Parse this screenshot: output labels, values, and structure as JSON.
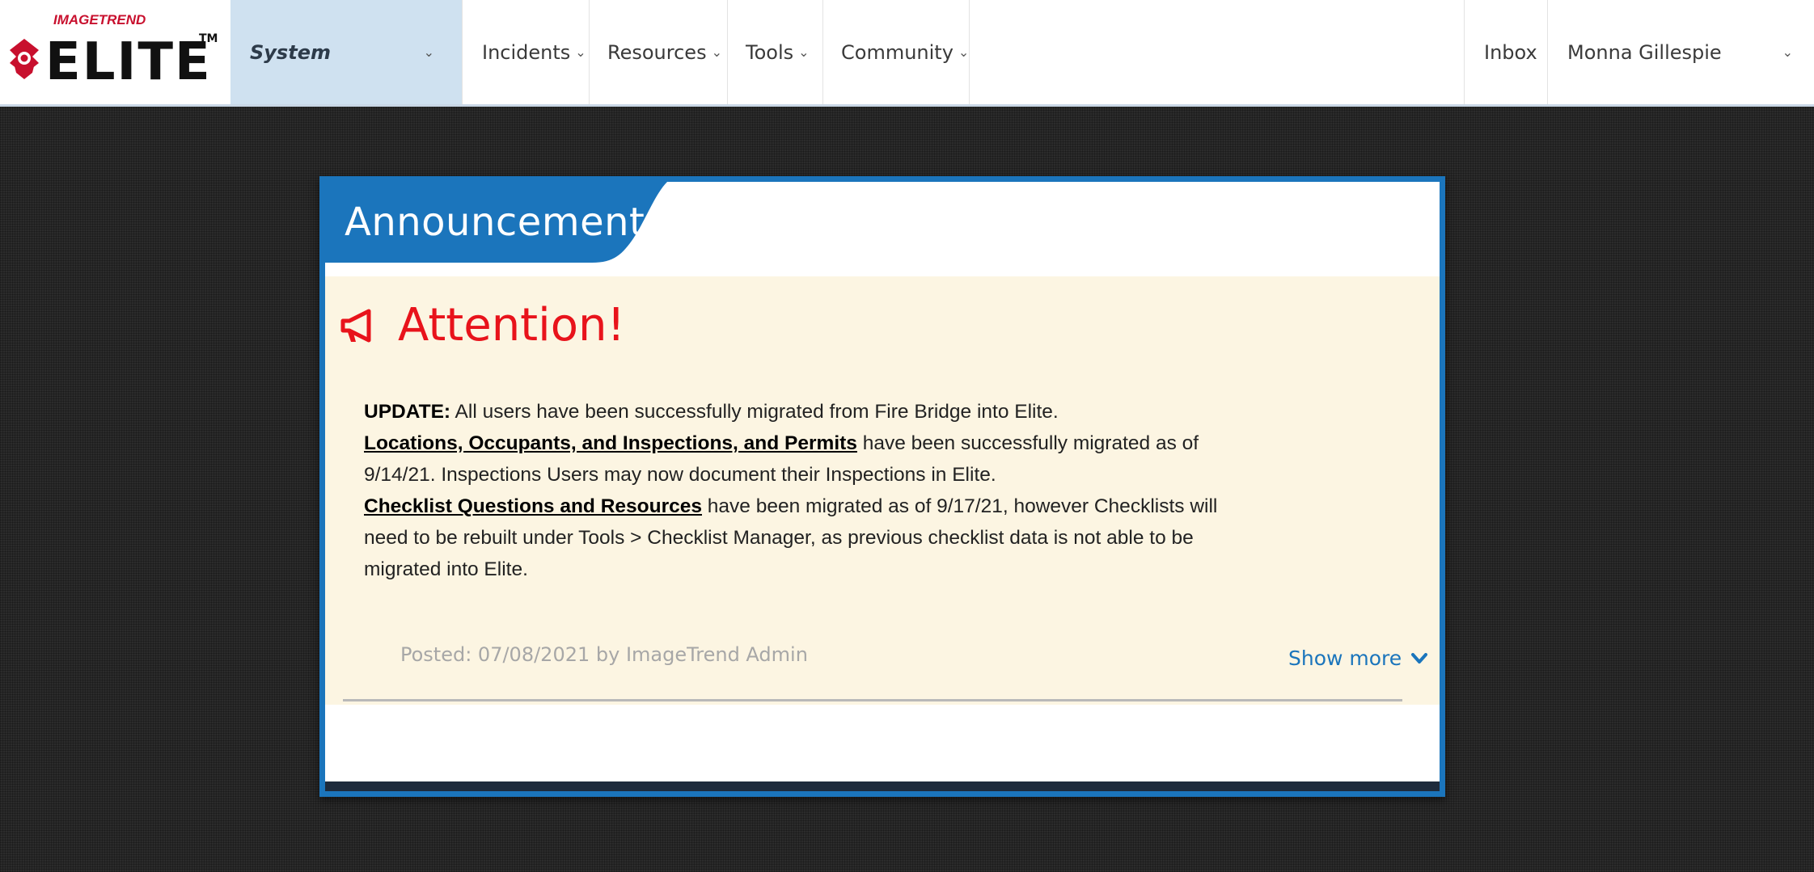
{
  "header": {
    "logo": {
      "small_text": "IMAGETREND",
      "big_text": "ELITE",
      "tm": "TM",
      "icon": "maltese-cross-icon"
    },
    "nav": [
      {
        "label": "System"
      },
      {
        "label": "Incidents"
      },
      {
        "label": "Resources"
      },
      {
        "label": "Tools"
      },
      {
        "label": "Community"
      }
    ],
    "inbox_label": "Inbox",
    "user_name": "Monna Gillespie",
    "chevron_icon": "chevron-down-icon"
  },
  "announcements": {
    "title": "Announcements",
    "items": [
      {
        "heading": "Attention!",
        "heading_icon": "megaphone-icon",
        "paragraphs": [
          {
            "strong": "UPDATE:",
            "text": " All users have been successfully migrated from Fire Bridge into Elite."
          },
          {
            "link": "Locations, Occupants, and Inspections, and Permits",
            "text": " have been successfully migrated as of 9/14/21. Inspections Users may now document their Inspections in Elite."
          },
          {
            "link": "Checklist Questions and Resources",
            "text": " have been migrated as of 9/17/21, however Checklists will need to be rebuilt under Tools > Checklist Manager, as previous checklist data is not able to be migrated into Elite."
          }
        ],
        "posted": "Posted: 07/08/2021 by ImageTrend Admin",
        "show_more_label": "Show more",
        "show_more_icon": "chevron-down-icon"
      }
    ]
  },
  "colors": {
    "brand_blue": "#1b75bc",
    "attention_red": "#e8131b",
    "announcement_bg": "#fcf5e2",
    "nav_active_bg": "#cfe1f0",
    "logo_red": "#c8102e"
  }
}
